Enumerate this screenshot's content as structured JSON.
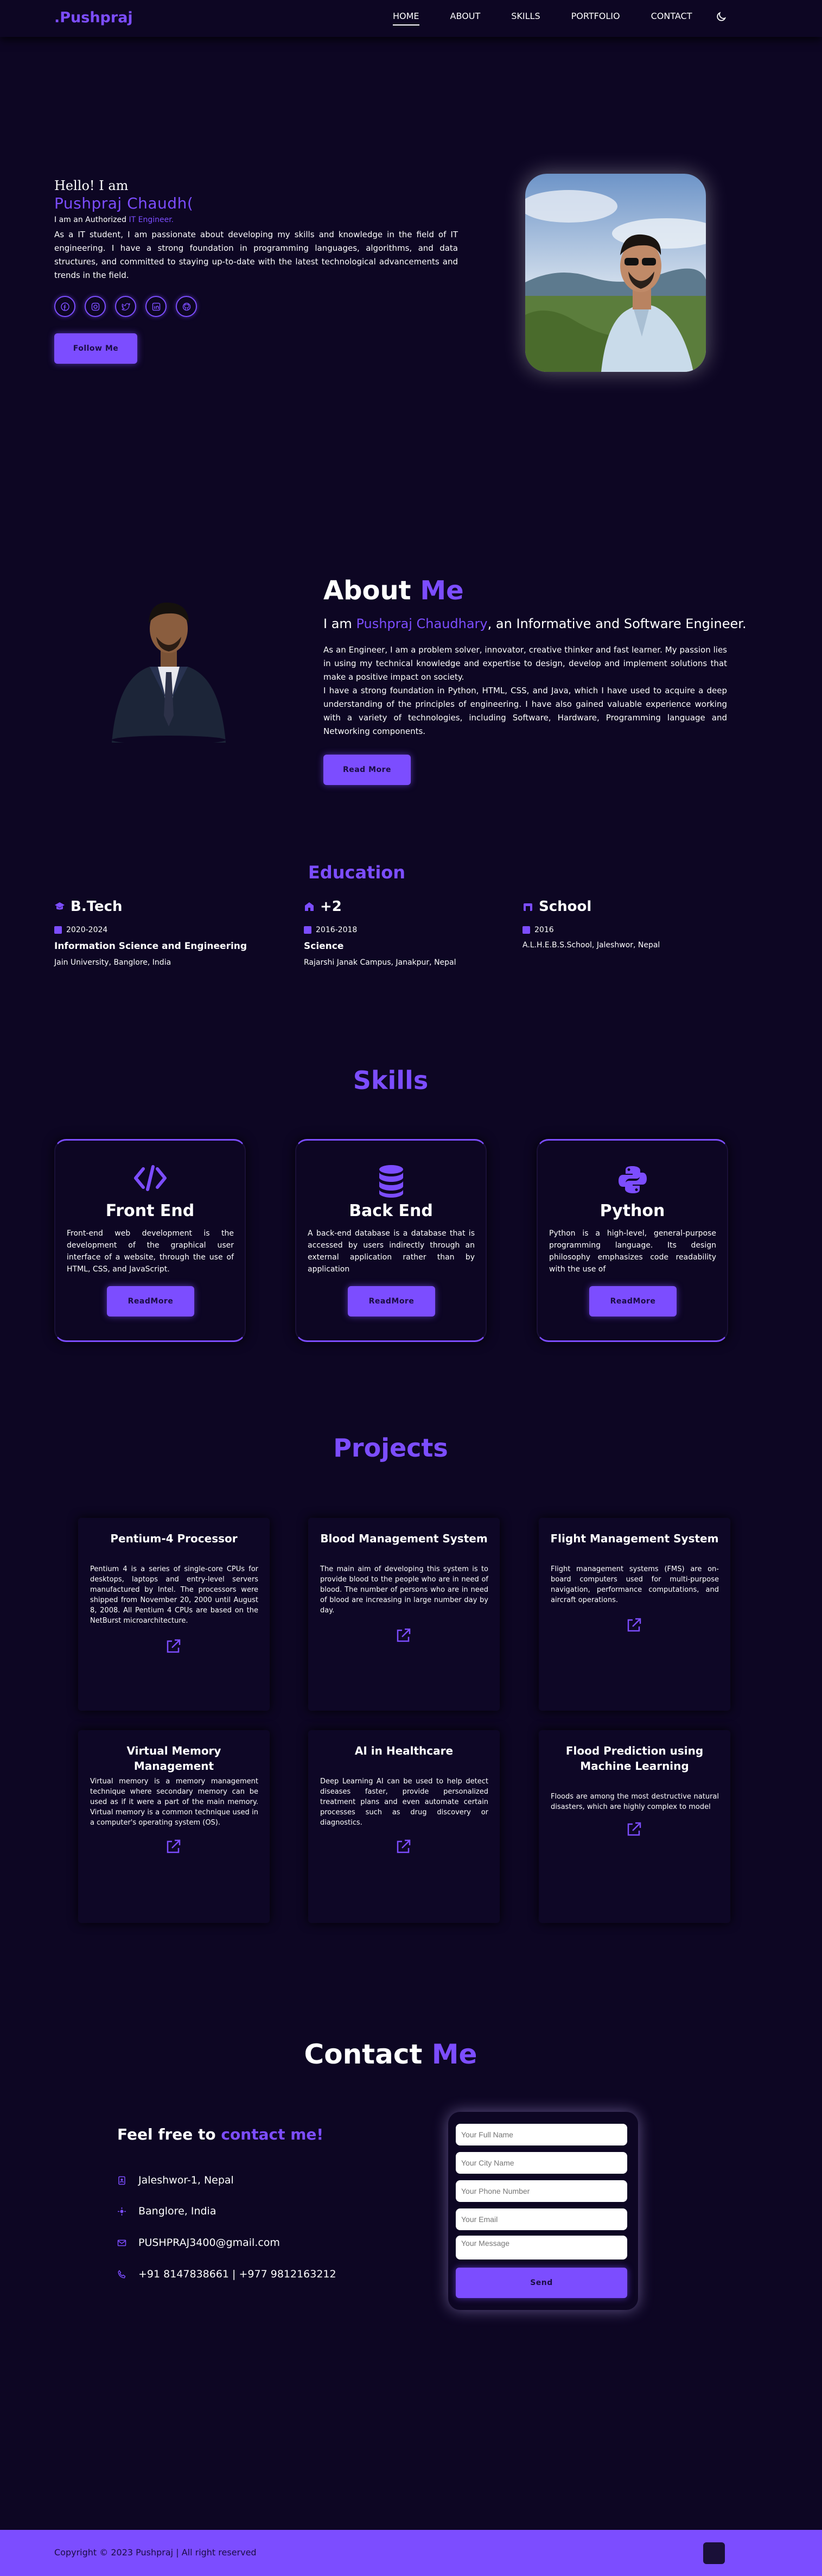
{
  "header": {
    "logo": ".Pushpraj",
    "nav": [
      "HOME",
      "ABOUT",
      "SKILLS",
      "PORTFOLIO",
      "CONTACT"
    ],
    "active": "HOME",
    "theme_icon": "moon-icon"
  },
  "hero": {
    "hello": "Hello! I am",
    "name": "Pushpraj Chaudh(",
    "role_prefix": "I am an Authorized",
    "role_typed": "IT Engineer.",
    "description": "As a IT student, I am passionate about developing my skills and knowledge in the field of IT engineering. I have a strong foundation in programming languages, algorithms, and data structures, and committed to staying up-to-date with the latest technological advancements and trends in the field.",
    "socials": [
      "facebook-icon",
      "instagram-icon",
      "twitter-icon",
      "linkedin-icon",
      "github-icon"
    ],
    "follow_label": "Follow Me"
  },
  "about": {
    "title_1": "About",
    "title_2": "Me",
    "sub_pre": "I am",
    "sub_name": "Pushpraj Chaudhary",
    "sub_post": ", an Informative and Software Engineer.",
    "p1": "As an Engineer, I am a problem solver, innovator, creative thinker and fast learner. My passion lies in using my technical knowledge and expertise to design, develop and implement solutions that make a positive impact on society.",
    "p2": "I have a strong foundation in Python, HTML, CSS, and Java, which I have used to acquire a deep understanding of the principles of engineering. I have also gained valuable experience working with a variety of technologies, including Software, Hardware, Programming language and Networking components.",
    "read_more": "Read More"
  },
  "education": {
    "title": "Education",
    "items": [
      {
        "heading": "B.Tech",
        "year": "2020-2024",
        "degree": "Information Science and Engineering",
        "institute": "Jain University, Banglore, India"
      },
      {
        "heading": "+2",
        "year": "2016-2018",
        "degree": "Science",
        "institute": "Rajarshi Janak Campus, Janakpur, Nepal"
      },
      {
        "heading": "School",
        "year": "2016",
        "degree": "",
        "institute": "A.L.H.E.B.S.School, Jaleshwor, Nepal"
      }
    ]
  },
  "skills": {
    "title": "Skills",
    "items": [
      {
        "name": "Front End",
        "desc": "Front-end web development is the development of the graphical user interface of a website, through the use of HTML, CSS, and JavaScript.",
        "btn": "ReadMore"
      },
      {
        "name": "Back End",
        "desc": "A back-end database is a database that is accessed by users indirectly through an external application rather than by application",
        "btn": "ReadMore"
      },
      {
        "name": "Python",
        "desc": "Python is a high-level, general-purpose programming language. Its design philosophy emphasizes code readability with the use of",
        "btn": "ReadMore"
      }
    ]
  },
  "projects": {
    "title": "Projects",
    "items": [
      {
        "name": "Pentium-4 Processor",
        "desc": "Pentium 4 is a series of single-core CPUs for desktops, laptops and entry-level servers manufactured by Intel. The processors were shipped from November 20, 2000 until August 8, 2008. All Pentium 4 CPUs are based on the NetBurst microarchitecture."
      },
      {
        "name": "Blood Management System",
        "desc": "The main aim of developing this system is to provide blood to the people who are in need of blood. The number of persons who are in need of blood are increasing in large number day by day."
      },
      {
        "name": "Flight Management System",
        "desc": "Flight management systems (FMS) are on-board computers used for multi-purpose navigation, performance computations, and aircraft operations."
      },
      {
        "name": "Virtual Memory Management",
        "desc": "Virtual memory is a memory management technique where secondary memory can be used as if it were a part of the main memory. Virtual memory is a common technique used in a computer's operating system (OS)."
      },
      {
        "name": "AI in Healthcare",
        "desc": "Deep Learning AI can be used to help detect diseases faster, provide personalized treatment plans and even automate certain processes such as drug discovery or diagnostics."
      },
      {
        "name": "Flood Prediction using Machine Learning",
        "desc": "Floods are among the most destructive natural disasters, which are highly complex to model"
      }
    ]
  },
  "contact": {
    "title_1": "Contact",
    "title_2": "Me",
    "free_1": "Feel free to",
    "free_2": "contact me!",
    "address": "Jaleshwor-1, Nepal",
    "address2": "Banglore, India",
    "email": "PUSHPRAJ3400@gmail.com",
    "phone": "+91 8147838661 | +977 9812163212",
    "form": {
      "name_ph": "Your Full Name",
      "city_ph": "Your City Name",
      "phone_ph": "Your Phone Number",
      "email_ph": "Your Email",
      "msg_ph": "Your Message",
      "send": "Send"
    }
  },
  "footer": {
    "copyright": "Copyright © 2023 Pushpraj | All right reserved"
  },
  "colors": {
    "accent": "#7c4dff",
    "bg": "#0d0623"
  }
}
